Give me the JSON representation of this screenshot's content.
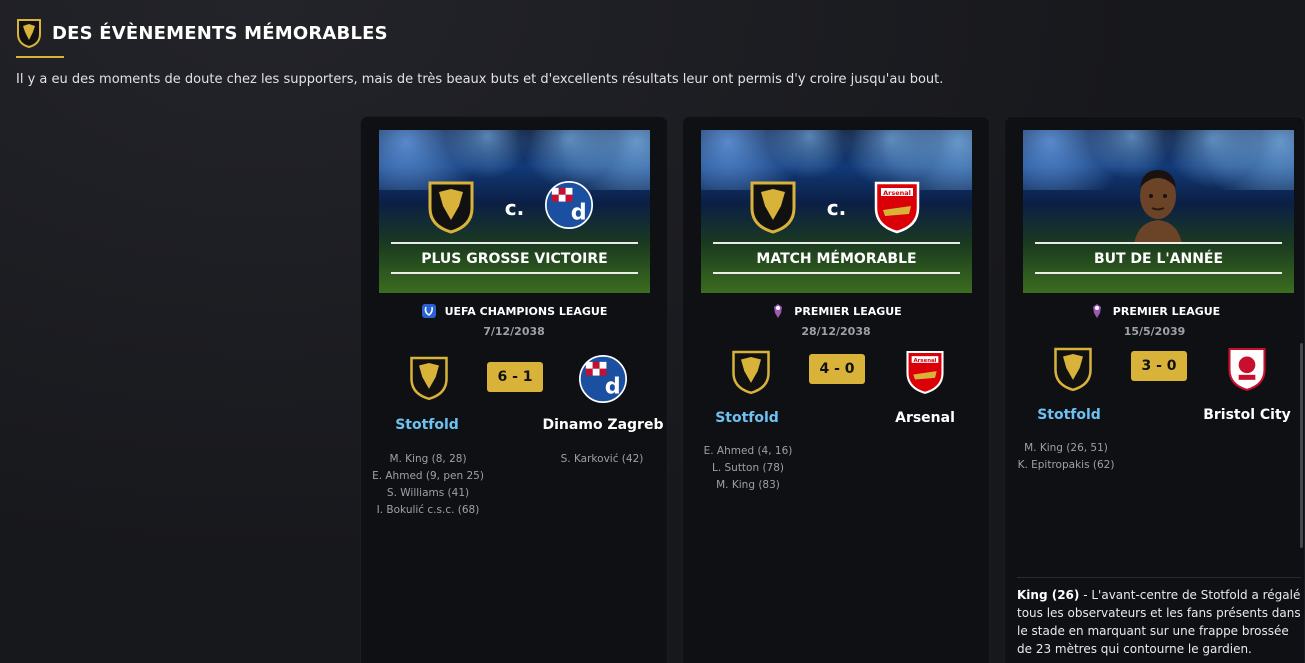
{
  "header": {
    "title": "DES ÉVÈNEMENTS MÉMORABLES",
    "subtitle": "Il y a eu des moments de doute chez les supporters, mais de très beaux buts et d'excellents résultats leur ont permis d'y croire jusqu'au bout."
  },
  "colors": {
    "accent": "#d9b23a",
    "home_team": "#6ec1f0",
    "background": "#17181c"
  },
  "cards": [
    {
      "banner_label": "PLUS GROSSE VICTOIRE",
      "vs": "c.",
      "competition": "UEFA CHAMPIONS LEAGUE",
      "date": "7/12/2038",
      "score": "6 - 1",
      "home_team": "Stotfold",
      "away_team": "Dinamo Zagreb",
      "home_scorers": [
        "M. King (8, 28)",
        "E. Ahmed (9, pen 25)",
        "S. Williams (41)",
        "I. Bokulić c.s.c. (68)"
      ],
      "away_scorers": [
        "S. Karković (42)"
      ]
    },
    {
      "banner_label": "MATCH MÉMORABLE",
      "vs": "c.",
      "competition": "PREMIER LEAGUE",
      "date": "28/12/2038",
      "score": "4 - 0",
      "home_team": "Stotfold",
      "away_team": "Arsenal",
      "home_scorers": [
        "E. Ahmed (4, 16)",
        "L. Sutton (78)",
        "M. King (83)"
      ],
      "away_scorers": []
    },
    {
      "banner_label": "BUT DE L'ANNÉE",
      "competition": "PREMIER LEAGUE",
      "date": "15/5/2039",
      "score": "3 - 0",
      "home_team": "Stotfold",
      "away_team": "Bristol City",
      "home_scorers": [
        "M. King (26, 51)",
        "K. Epitropakis (62)"
      ],
      "away_scorers": [],
      "description_player": "King (26)",
      "description_text": " - L'avant-centre de Stotfold a régalé tous les observateurs et les fans présents dans le stade en marquant sur une frappe brossée de 23 mètres qui contourne le gardien."
    }
  ],
  "crest_texts": {
    "arsenal": "Arsenal",
    "zagreb": "d"
  }
}
